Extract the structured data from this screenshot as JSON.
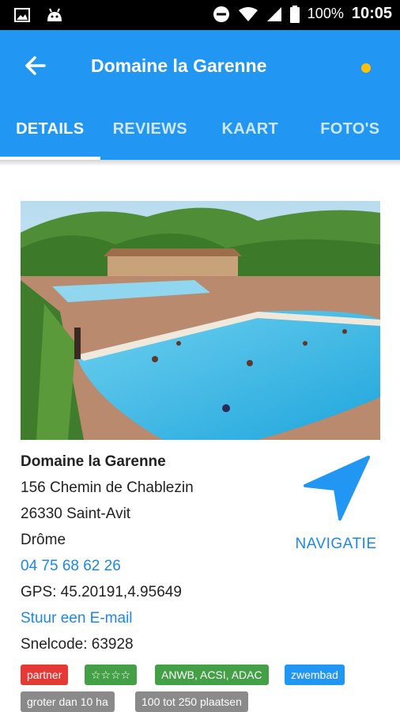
{
  "statusbar": {
    "battery": "100%",
    "time": "10:05"
  },
  "appbar": {
    "title": "Domaine la Garenne"
  },
  "tabs": [
    {
      "label": "DETAILS"
    },
    {
      "label": "REVIEWS"
    },
    {
      "label": "KAART"
    },
    {
      "label": "FOTO'S"
    }
  ],
  "details": {
    "name": "Domaine la Garenne",
    "address1": "156 Chemin de Chablezin",
    "address2": "26330 Saint-Avit",
    "region": "Drôme",
    "phone": "04 75 68 62 26",
    "gps": "GPS: 45.20191,4.95649",
    "email_link": "Stuur een E-mail",
    "snelcode": "Snelcode: 63928"
  },
  "navigation": {
    "label": "NAVIGATIE"
  },
  "badges": [
    {
      "label": "partner",
      "color": "#e53935"
    },
    {
      "label": "☆☆☆☆",
      "color": "#43a047"
    },
    {
      "label": "ANWB, ACSI, ADAC",
      "color": "#43a047"
    },
    {
      "label": "zwembad",
      "color": "#2196f3"
    },
    {
      "label": "groter dan 10 ha",
      "color": "#8a8a8a"
    },
    {
      "label": "100 tot 250 plaatsen",
      "color": "#8a8a8a"
    }
  ],
  "colors": {
    "primary": "#2196f3",
    "link": "#1e88e5",
    "indicator": "#ffc107"
  }
}
